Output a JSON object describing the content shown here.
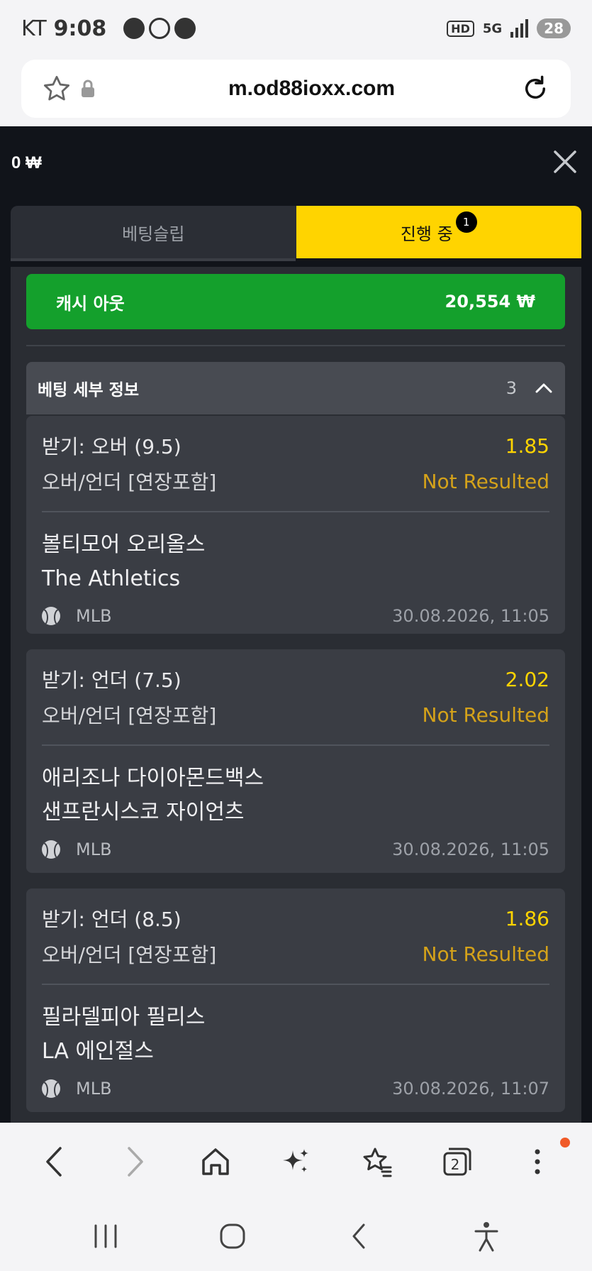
{
  "status_bar": {
    "carrier": "KT",
    "time": "9:08",
    "network": "5G",
    "hd": "HD",
    "battery": "28"
  },
  "browser": {
    "url": "m.od88ioxx.com"
  },
  "app": {
    "balance": "0 ₩",
    "tabs": [
      {
        "label": "베팅슬립",
        "active": false
      },
      {
        "label": "진행 중",
        "active": true,
        "badge": "1"
      }
    ],
    "cashout": {
      "label": "캐시 아웃",
      "amount": "20,554 ₩"
    },
    "details": {
      "title": "베팅 세부 정보",
      "count": "3"
    },
    "bets": [
      {
        "pick": "받기: 오버 (9.5)",
        "odds": "1.85",
        "market": "오버/언더 [연장포함]",
        "status": "Not Resulted",
        "team1": "볼티모어 오리올스",
        "team2": "The Athletics",
        "league": "MLB",
        "date": "30.08.2026, 11:05"
      },
      {
        "pick": "받기: 언더 (7.5)",
        "odds": "2.02",
        "market": "오버/언더 [연장포함]",
        "status": "Not Resulted",
        "team1": "애리조나 다이아몬드백스",
        "team2": "샌프란시스코 자이언츠",
        "league": "MLB",
        "date": "30.08.2026, 11:05"
      },
      {
        "pick": "받기: 언더 (8.5)",
        "odds": "1.86",
        "market": "오버/언더 [연장포함]",
        "status": "Not Resulted",
        "team1": "필라델피아 필리스",
        "team2": "LA 에인절스",
        "league": "MLB",
        "date": "30.08.2026, 11:07"
      }
    ]
  },
  "browser_nav": {
    "tab_count": "2"
  },
  "colors": {
    "accent_yellow": "#ffd400",
    "cashout_green": "#14a02c",
    "status_amber": "#d4a21a",
    "background_dark": "#11141a"
  }
}
